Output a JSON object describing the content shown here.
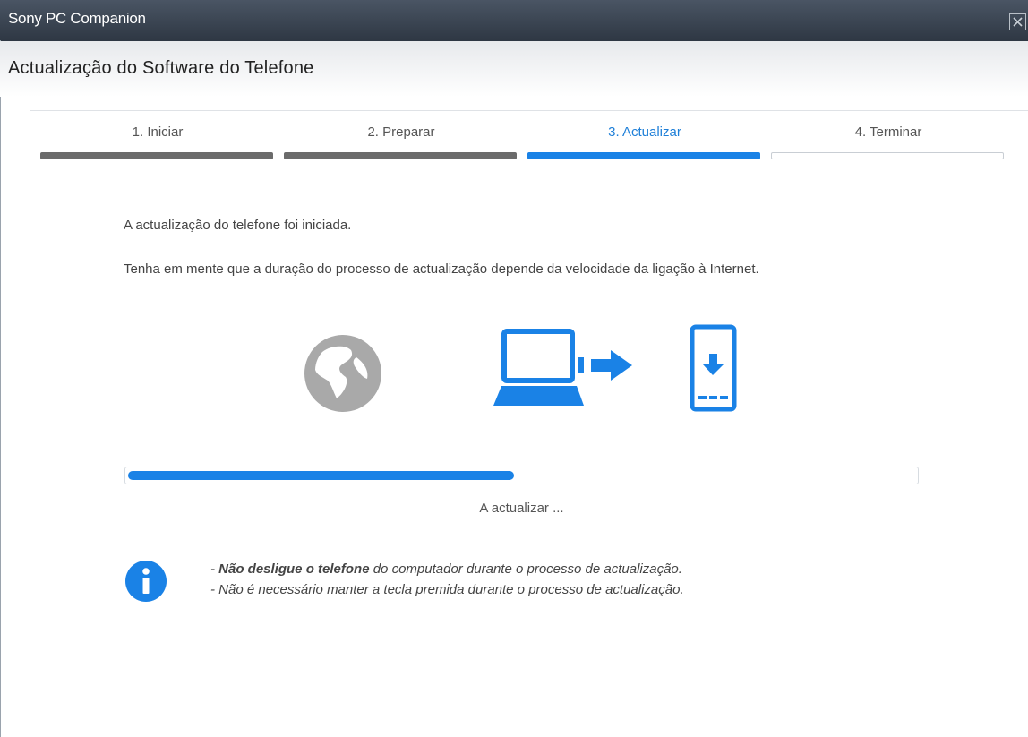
{
  "window": {
    "title": "Sony PC Companion",
    "close_icon": "close-icon"
  },
  "header": {
    "title": "Actualização do Software do Telefone"
  },
  "steps": [
    {
      "label": "1. Iniciar",
      "state": "done"
    },
    {
      "label": "2. Preparar",
      "state": "done"
    },
    {
      "label": "3. Actualizar",
      "state": "active"
    },
    {
      "label": "4. Terminar",
      "state": "pending"
    }
  ],
  "main": {
    "started_text": "A actualização do telefone foi iniciada.",
    "duration_text": "Tenha em mente que a duração do processo de actualização depende da velocidade da ligação à Internet.",
    "illustration": {
      "icons": [
        "globe-icon",
        "laptop-icon",
        "arrow-right-icon",
        "phone-download-icon"
      ]
    },
    "progress": {
      "fraction": 0.49,
      "status": "A actualizar ..."
    },
    "info": {
      "icon": "info-icon",
      "line1_prefix": "- ",
      "line1_bold": "Não desligue o telefone",
      "line1_rest": " do computador durante o processo de actualização.",
      "line2": "- Não é necessário manter a tecla premida durante o processo de actualização."
    }
  },
  "colors": {
    "accent": "#1a82e6",
    "completed": "#6b6b6b",
    "titlebar": "#353f4c",
    "icon_gray": "#a9a9a9"
  }
}
